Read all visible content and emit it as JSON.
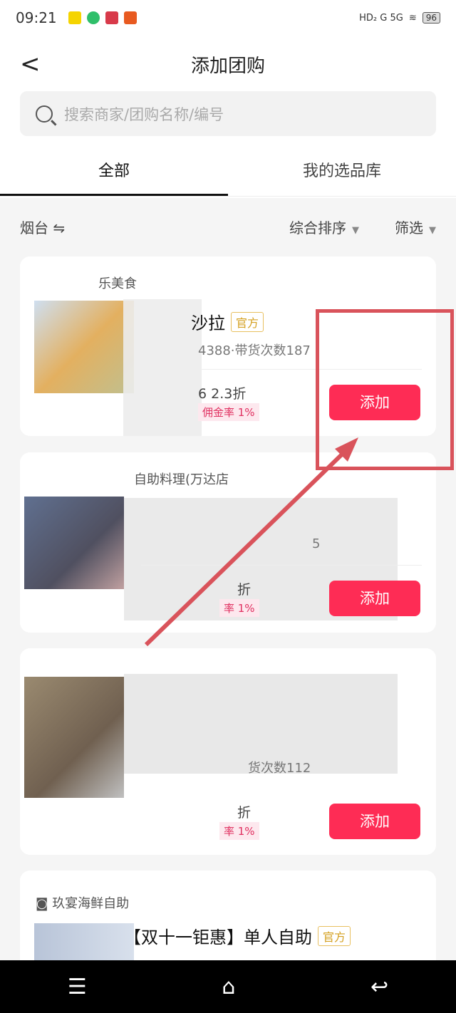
{
  "status": {
    "time": "09:21",
    "battery": "96",
    "signal": "HD₂ G 5G"
  },
  "header": {
    "title": "添加团购",
    "search_placeholder": "搜索商家/团购名称/编号"
  },
  "tabs": [
    {
      "label": "全部",
      "active": true
    },
    {
      "label": "我的选品库",
      "active": false
    }
  ],
  "filter": {
    "city": "烟台",
    "sort": "综合排序",
    "filter": "筛选"
  },
  "cards": [
    {
      "shop": "乐美食",
      "name": "沙拉",
      "badge": "官方",
      "meta": "4388·带货次数187",
      "price": "6  2.3折",
      "commission": "佣金率 1%",
      "add": "添加"
    },
    {
      "shop": "自助料理(万达店",
      "name": "",
      "badge": "",
      "meta": "5",
      "price": "折",
      "commission": "率 1%",
      "add": "添加"
    },
    {
      "shop": "",
      "name": "",
      "badge": "",
      "meta": "货次数112",
      "price": "折",
      "commission": "率 1%",
      "add": "添加"
    },
    {
      "shop": "玖宴海鲜自助",
      "name": "【双十一钜惠】单人自助",
      "badge": "官方",
      "meta": "",
      "price": "",
      "commission": "",
      "add": ""
    }
  ],
  "colors": {
    "accent": "#fe2c55",
    "badge": "#d4a020",
    "annotation": "#d9535b"
  }
}
